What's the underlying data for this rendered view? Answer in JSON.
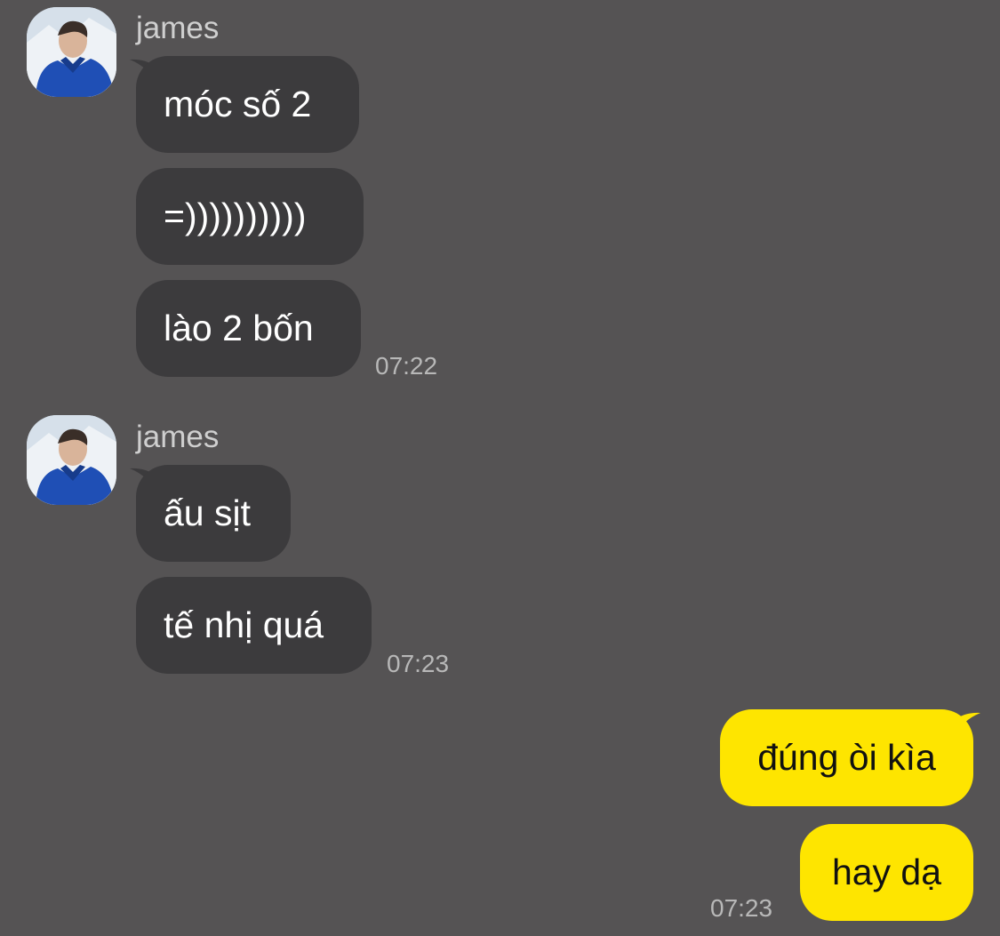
{
  "groups": [
    {
      "sender": "james",
      "messages": [
        "móc số 2",
        "=))))))))))",
        "lào 2 bốn"
      ],
      "time": "07:22"
    },
    {
      "sender": "james",
      "messages": [
        "ấu sịt",
        "tế nhị quá"
      ],
      "time": "07:23"
    }
  ],
  "outgoing": {
    "messages": [
      "đúng òi kìa",
      "hay dạ"
    ],
    "time": "07:23"
  },
  "colors": {
    "background": "#555354",
    "incoming_bubble": "#3c3b3d",
    "outgoing_bubble": "#fee500"
  }
}
